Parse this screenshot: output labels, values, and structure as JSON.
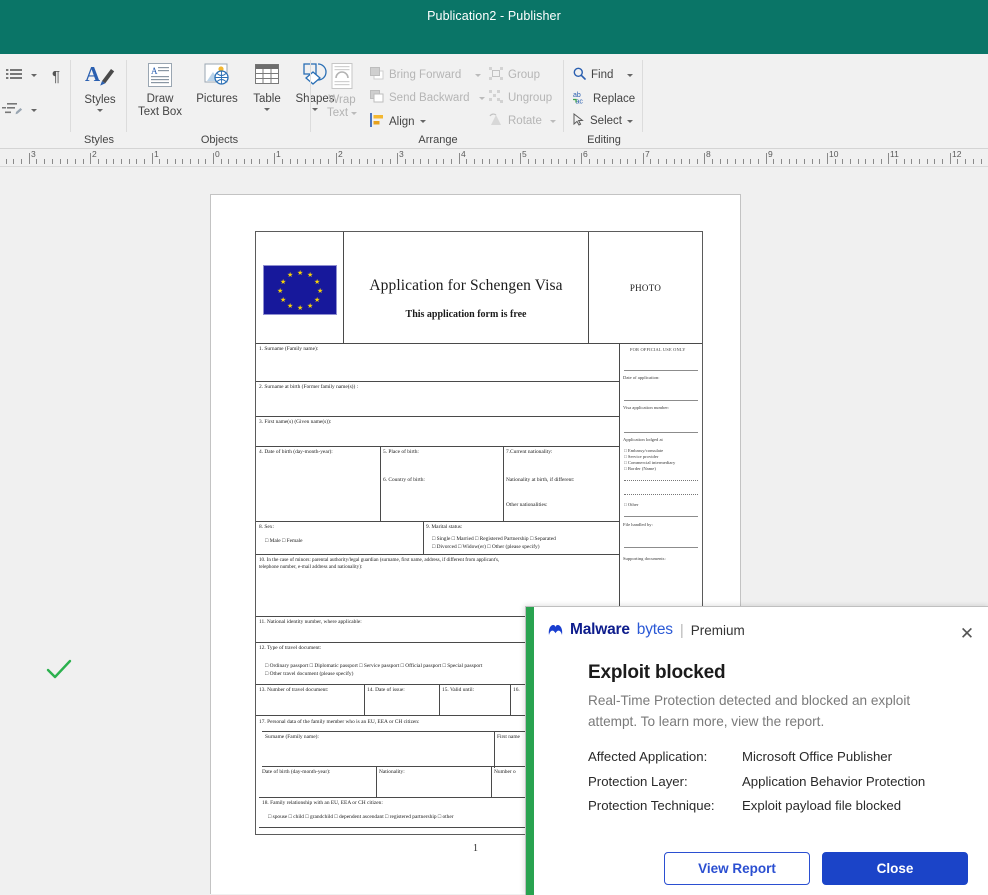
{
  "window": {
    "title": "Publication2 - Publisher",
    "titlebar_color": "#0a7567"
  },
  "ribbon": {
    "groups": [
      {
        "label": "Styles"
      },
      {
        "label": "Objects"
      },
      {
        "label": "Arrange"
      },
      {
        "label": "Editing"
      }
    ],
    "buttons": {
      "paragraph_mark": "¶",
      "styles": "Styles",
      "draw_text_box_l1": "Draw",
      "draw_text_box_l2": "Text Box",
      "pictures": "Pictures",
      "table": "Table",
      "shapes": "Shapes",
      "wrap_text_l1": "Wrap",
      "wrap_text_l2": "Text",
      "bring_forward": "Bring Forward",
      "send_backward": "Send Backward",
      "align": "Align",
      "group": "Group",
      "ungroup": "Ungroup",
      "rotate": "Rotate",
      "find": "Find",
      "replace": "Replace",
      "select": "Select"
    }
  },
  "ruler": {
    "labels": [
      "3",
      "2",
      "1",
      "0",
      "1",
      "2",
      "3",
      "4",
      "5",
      "6",
      "7",
      "8",
      "9",
      "10",
      "11",
      "12"
    ]
  },
  "document": {
    "page_number": "1",
    "form": {
      "title": "Application for Schengen Visa",
      "subtitle": "This application form is free",
      "photo_label": "PHOTO",
      "official_use_header": "FOR OFFICIAL USE ONLY",
      "fields": [
        "1. Surname (Family name):",
        "2. Surname at birth (Former family name(s)) :",
        "3. First name(s) (Given name(s)):",
        "4. Date of birth (day-month-year):",
        "5. Place of birth:",
        "6. Country of birth:",
        "7.Current nationality:",
        "Nationality at birth, if different:",
        "Other nationalities:",
        "8. Sex:",
        "□ Male □ Female",
        "9. Marital status:",
        "□ Single □ Married □ Registered Partnership □ Separated",
        "□ Divorced □ Widow(er) □ Other (please specify)",
        "10. In the case of minors: parental authority/legal guardian (surname, first name, address, if different from applicant's,",
        "telephone number, e-mail address and nationality):",
        "11. National identity number, where applicable:",
        "12. Type of travel document:",
        "□ Ordinary passport □ Diplomatic passport □ Service passport □ Official passport □ Special passport",
        "□ Other travel document (please specify)",
        "13. Number of travel document:",
        "14. Date of issue:",
        "15. Valid until:",
        "16.",
        "17. Personal data of the family member who is an EU, EEA or CH citizen:",
        "Surname (Family name):",
        "First name",
        "Date of birth (day-month-year):",
        "Nationality:",
        "Number o",
        "18. Family relationship with an EU, EEA or CH citizen:",
        "□ spouse □ child □ grandchild □ dependent ascendant □ registered partnership □ other"
      ],
      "official_use_fields": [
        "Date of application:",
        "Visa application number:",
        "Application lodged at",
        "□ Embassy/consulate",
        "□ Service provider",
        "□ Commercial intermediary",
        "□ Border (Name)",
        "□ Other",
        "File handled by:",
        "Supporting documents:"
      ]
    }
  },
  "malwarebytes": {
    "brand_part1": "Malware",
    "brand_part2": "bytes",
    "brand_divider": "|",
    "edition": "Premium",
    "close_icon_label": "✕",
    "alert_title": "Exploit blocked",
    "alert_description": "Real-Time Protection detected and blocked an exploit attempt. To learn more, view the report.",
    "details": [
      {
        "key": "Affected Application:",
        "value": "Microsoft Office Publisher"
      },
      {
        "key": "Protection Layer:",
        "value": "Application Behavior Protection"
      },
      {
        "key": "Protection Technique:",
        "value": "Exploit payload file blocked"
      }
    ],
    "buttons": {
      "view_report": "View Report",
      "close": "Close"
    },
    "colors": {
      "accent_green": "#29a350",
      "primary_blue": "#1b44c8",
      "brand_dark": "#0d1c8c"
    }
  }
}
